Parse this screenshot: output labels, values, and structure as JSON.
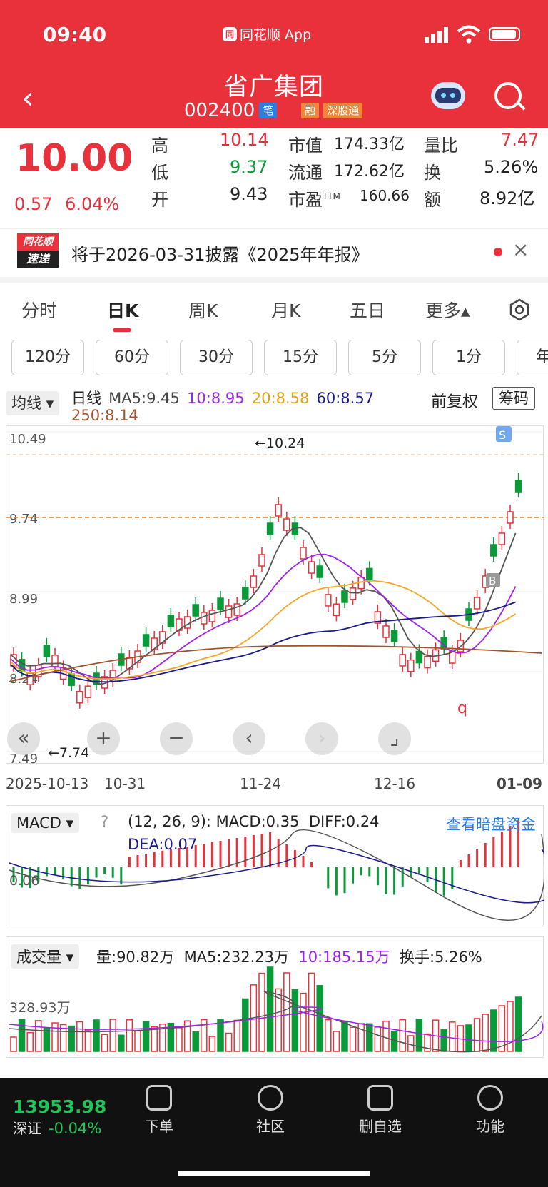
{
  "status": {
    "time": "09:40",
    "app_name": "同花顺 App",
    "app_logo": "同"
  },
  "stock": {
    "name": "省广集团",
    "code": "002400",
    "tag1": "笔",
    "tag2": "融",
    "tag3": "深股通"
  },
  "quote": {
    "price": "10.00",
    "change": "0.57",
    "change_pct": "6.04%",
    "high_label": "高",
    "high": "10.14",
    "low_label": "低",
    "low": "9.37",
    "open_label": "开",
    "open": "9.43",
    "mktcap_label": "市值",
    "mktcap": "174.33亿",
    "float_label": "流通",
    "float": "172.62亿",
    "pe_label": "市盈",
    "pe_sup": "TTM",
    "pe": "160.66",
    "vr_label": "量比",
    "vr": "7.47",
    "turn_label": "换",
    "turn": "5.26%",
    "amount_label": "额",
    "amount": "8.92亿"
  },
  "notice": {
    "badge_top": "同花顺",
    "badge_bottom": "速递",
    "text": "将于2026-03-31披露《2025年年报》",
    "close": "×"
  },
  "tabs": [
    "分时",
    "日K",
    "周K",
    "月K",
    "五日",
    "更多▴"
  ],
  "periods": [
    "120分",
    "60分",
    "30分",
    "15分",
    "5分",
    "1分",
    "年"
  ],
  "kinfo": {
    "selector": "均线 ▾",
    "type": "日线",
    "ma5": "MA5:9.45",
    "ma10": "10:8.95",
    "ma20": "20:8.58",
    "ma60": "60:8.57",
    "ma250": "250:8.14",
    "fq": "前复权",
    "chips": "筹码"
  },
  "colors": {
    "red": "#e8313b",
    "green": "#0a9a3a",
    "ma5": "#555555",
    "ma10": "#a020f0",
    "ma20": "#f5a623",
    "ma60": "#1a1a8c",
    "ma250": "#a0522d"
  },
  "chart": {
    "y_labels": [
      "10.49",
      "9.74",
      "8.99",
      "8.24",
      "7.49"
    ],
    "high_note": "←10.24",
    "low_note": "←7.74",
    "s_mark": "S",
    "b_mark": "B",
    "q_mark": "q",
    "dates": [
      "2025-10-13",
      "10-31",
      "11-24",
      "12-16",
      "01-09"
    ]
  },
  "controls": [
    "«",
    "+",
    "−",
    "‹",
    "›",
    "⌟"
  ],
  "macd": {
    "selector": "MACD ▾",
    "help": "?",
    "params": "(12, 26, 9):",
    "macd": "MACD:0.35",
    "diff": "DIFF:0.24",
    "dea": "DEA:0.07",
    "link": "查看暗盘资金",
    "y_label": "0.06"
  },
  "volume": {
    "selector": "成交量 ▾",
    "vol": "量:90.82万",
    "ma5": "MA5:232.23万",
    "ma10": "10:185.15万",
    "turnover": "换手:5.26%",
    "y_label": "328.93万"
  },
  "bottom": {
    "index_value": "13953.98",
    "index_name": "深证",
    "index_pct": "-0.04%",
    "nav": [
      "下单",
      "社区",
      "删自选",
      "功能"
    ]
  }
}
